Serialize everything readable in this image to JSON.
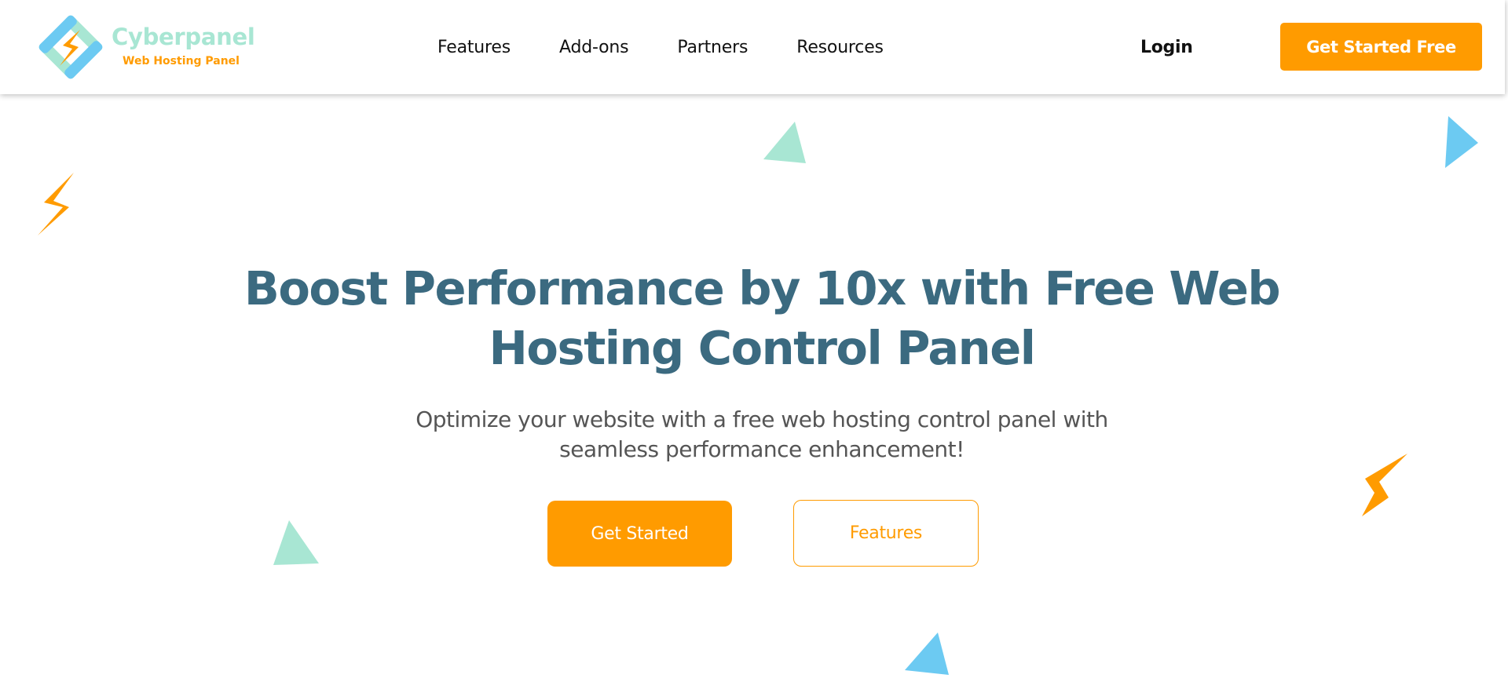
{
  "brand": {
    "name": "Cyberpanel",
    "tagline": "Web Hosting Panel",
    "logo_icon": "lightning-diamond-logo-icon"
  },
  "nav": {
    "items": [
      {
        "label": "Features"
      },
      {
        "label": "Add-ons"
      },
      {
        "label": "Partners"
      },
      {
        "label": "Resources"
      }
    ],
    "login_label": "Login",
    "cta_label": "Get Started Free"
  },
  "hero": {
    "title_line1": "Boost Performance by 10x with Free Web",
    "title_line2": "Hosting Control Panel",
    "subtitle_line1": "Optimize your website with a free web hosting control panel with",
    "subtitle_line2": "seamless performance enhancement!",
    "primary_button": "Get Started",
    "secondary_button": "Features"
  },
  "decorations": [
    {
      "icon": "lightning-bolt-icon",
      "color": "#ff9b00"
    },
    {
      "icon": "triangle-icon",
      "color": "#a8e6d3"
    },
    {
      "icon": "triangle-icon",
      "color": "#6ccaf2"
    },
    {
      "icon": "lightning-bolt-icon",
      "color": "#ff9b00"
    },
    {
      "icon": "triangle-icon",
      "color": "#a8e6d3"
    },
    {
      "icon": "triangle-icon",
      "color": "#6ccaf2"
    }
  ],
  "colors": {
    "accent": "#ff9b00",
    "heading": "#3b6a80",
    "mint": "#a8e6d3",
    "sky": "#6ccaf2",
    "body_text": "#555555"
  }
}
